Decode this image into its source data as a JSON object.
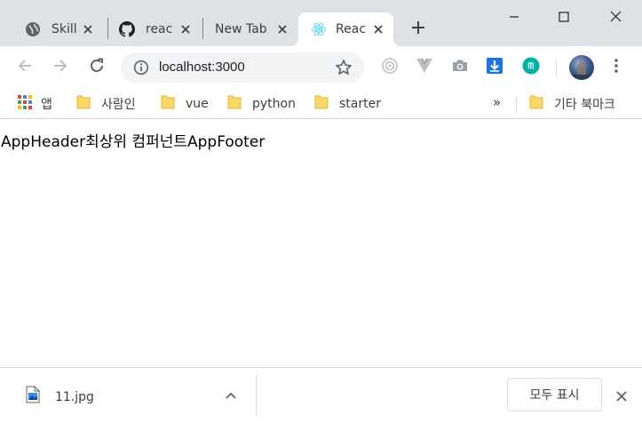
{
  "window": {
    "tabs": [
      {
        "label": "Skill",
        "icon": "globe-icon",
        "active": false
      },
      {
        "label": "reac",
        "icon": "github-icon",
        "active": false
      },
      {
        "label": "New Tab",
        "icon": "",
        "active": false
      },
      {
        "label": "Reac",
        "icon": "react-icon",
        "active": true
      }
    ],
    "new_tab_icon": "plus-icon",
    "controls": [
      "minimize-icon",
      "maximize-icon",
      "close-icon"
    ]
  },
  "toolbar": {
    "url": "localhost:3000",
    "nav_icons": [
      "back-arrow-icon",
      "forward-arrow-icon",
      "reload-icon"
    ],
    "extensions": [
      "target-icon",
      "vue-devtools-icon",
      "camera-icon",
      "download-arrow-icon",
      "m-circle-icon"
    ],
    "menu_icon": "kebab-menu-icon"
  },
  "bookmarks": {
    "apps_label": "앱",
    "items": [
      {
        "label": "사람인"
      },
      {
        "label": "vue"
      },
      {
        "label": "python"
      },
      {
        "label": "starter"
      }
    ],
    "more_label": "»",
    "other_label": "기타 북마크"
  },
  "page": {
    "text": "AppHeader최상위 컴퍼넌트AppFooter"
  },
  "downloads": {
    "file_name": "11.jpg",
    "show_all_label": "모두 표시"
  },
  "colors": {
    "tab_strip": "#dee1e6",
    "omnibox": "#f1f3f4",
    "react_blue": "#61dafb",
    "download_blue": "#1a73e8",
    "ext_teal": "#00b3a7",
    "folder_yellow": "#fbd866"
  }
}
